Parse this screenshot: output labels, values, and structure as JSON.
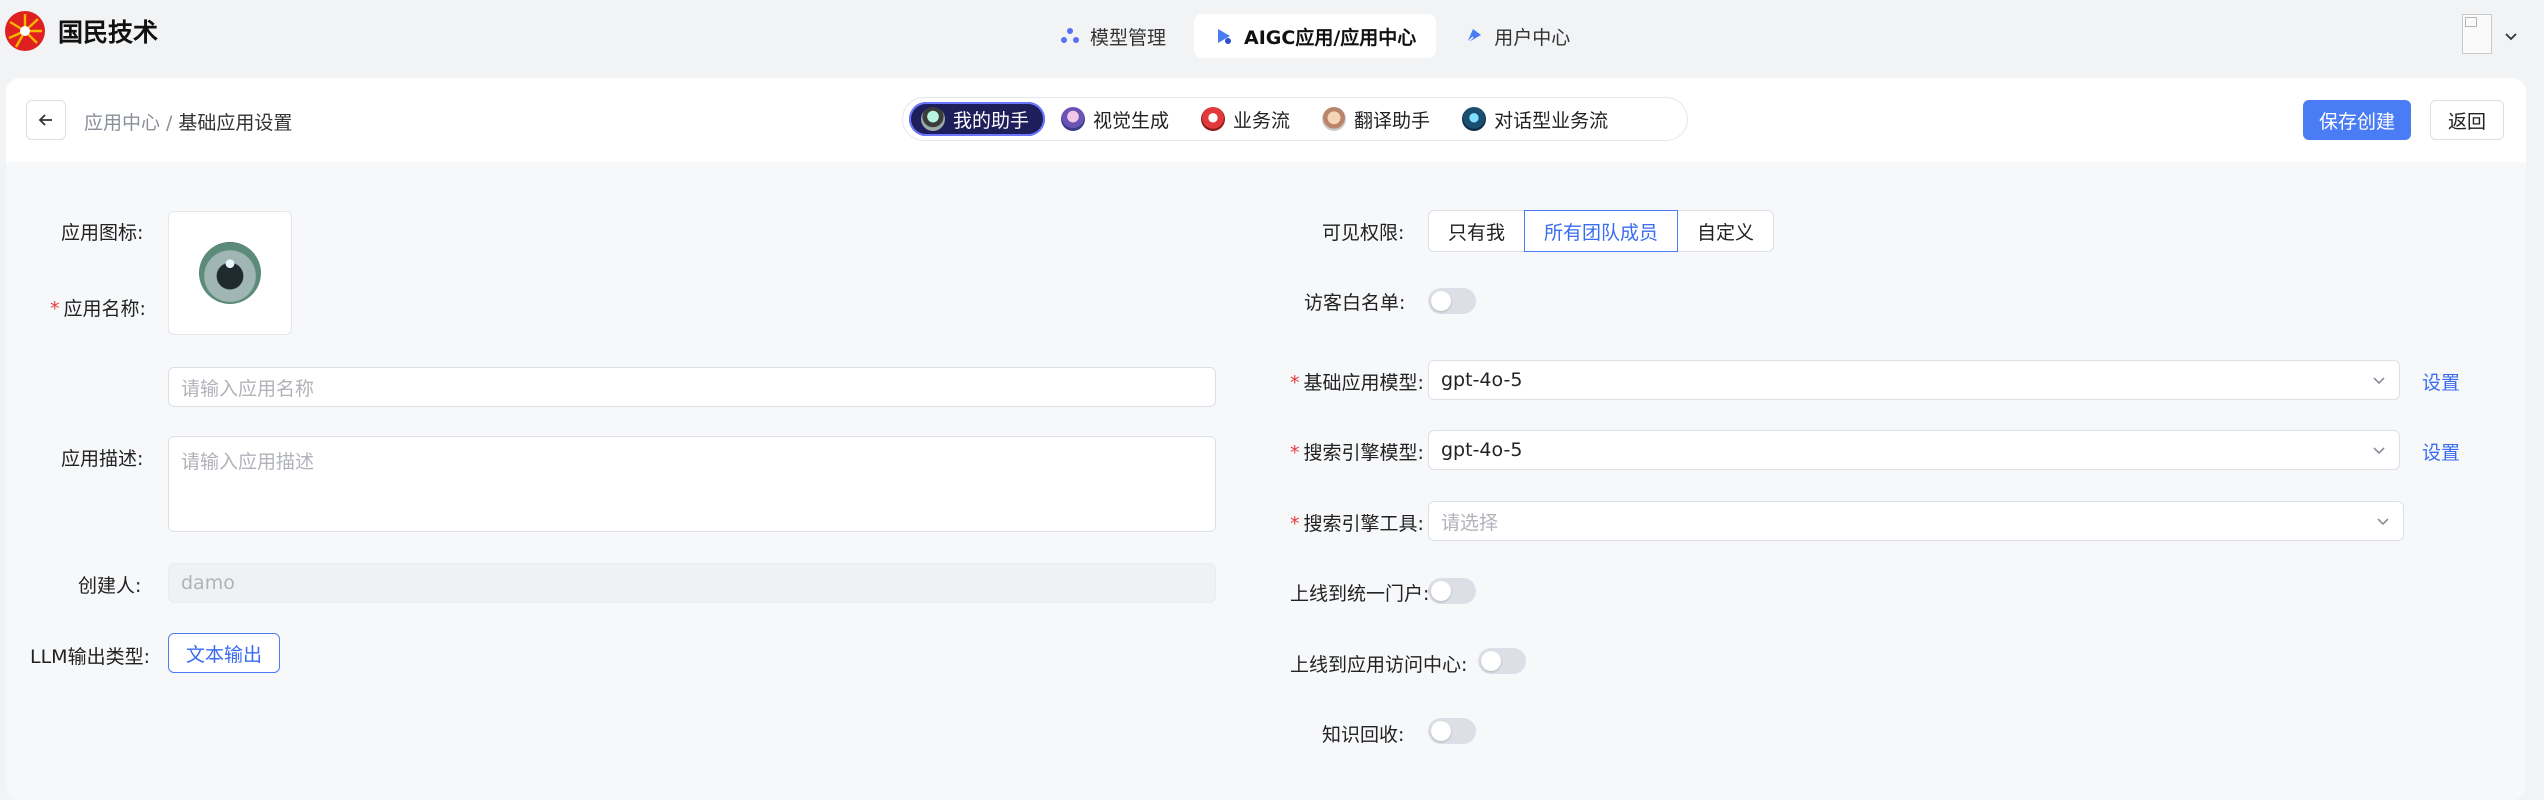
{
  "brand": {
    "name": "国民技术",
    "logo_icon": "sunburst-logo-icon",
    "logo_colors": [
      "#e02020",
      "#f7b500"
    ]
  },
  "topnav": {
    "items": [
      {
        "label": "模型管理",
        "icon": "model-icon",
        "active": false
      },
      {
        "label": "AIGC应用/应用中心",
        "icon": "app-center-icon",
        "active": true
      },
      {
        "label": "用户中心",
        "icon": "user-center-icon",
        "active": false
      }
    ]
  },
  "header": {
    "breadcrumb": {
      "parent": "应用中心",
      "separator": "/",
      "current": "基础应用设置"
    },
    "tabs": [
      {
        "label": "我的助手",
        "active": true
      },
      {
        "label": "视觉生成",
        "active": false
      },
      {
        "label": "业务流",
        "active": false
      },
      {
        "label": "翻译助手",
        "active": false
      },
      {
        "label": "对话型业务流",
        "active": false
      }
    ],
    "save_label": "保存创建",
    "back_label": "返回"
  },
  "form_left": {
    "icon_label": "应用图标:",
    "name_label": "应用名称:",
    "name_placeholder": "请输入应用名称",
    "desc_label": "应用描述:",
    "desc_placeholder": "请输入应用描述",
    "creator_label": "创建人:",
    "creator_value": "damo",
    "llm_label": "LLM输出类型:",
    "llm_value": "文本输出"
  },
  "form_right": {
    "visibility_label": "可见权限:",
    "visibility_options": [
      "只有我",
      "所有团队成员",
      "自定义"
    ],
    "visibility_selected": "所有团队成员",
    "whitelist_label": "访客白名单:",
    "whitelist_on": false,
    "base_model_label": "基础应用模型:",
    "base_model_value": "gpt-4o-5",
    "search_model_label": "搜索引擎模型:",
    "search_model_value": "gpt-4o-5",
    "settings_label": "设置",
    "search_tool_label": "搜索引擎工具:",
    "search_tool_placeholder": "请选择",
    "portal_label": "上线到统一门户:",
    "portal_on": false,
    "access_center_label": "上线到应用访问中心:",
    "access_center_on": false,
    "knowledge_label": "知识回收:",
    "knowledge_on": false
  },
  "colors": {
    "primary": "#4a7cf6",
    "active_tab": "#1e1e5a",
    "required": "#e4393c"
  }
}
